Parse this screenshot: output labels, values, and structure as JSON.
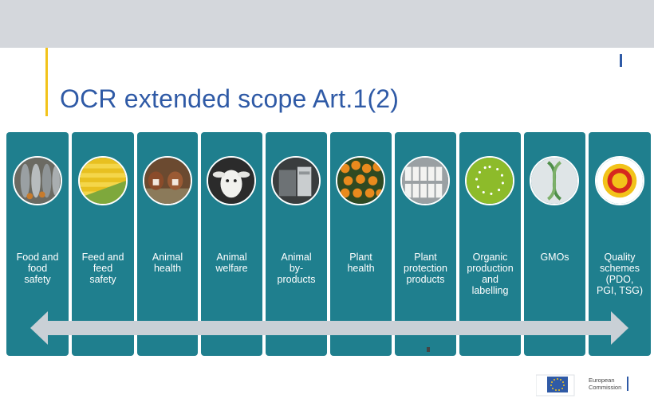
{
  "slide": {
    "title": "OCR extended scope Art.1(2)",
    "cards": [
      {
        "label": "Food and\nfood\nsafety",
        "icon": "fish-icon"
      },
      {
        "label": "Feed and\nfeed\nsafety",
        "icon": "corn-icon"
      },
      {
        "label": "Animal\nhealth",
        "icon": "cattle-icon"
      },
      {
        "label": "Animal\nwelfare",
        "icon": "goat-icon"
      },
      {
        "label": "Animal\nby-\nproducts",
        "icon": "byproducts-icon"
      },
      {
        "label": "Plant\nhealth",
        "icon": "citrus-icon"
      },
      {
        "label": "Plant\nprotection\nproducts",
        "icon": "bottles-icon"
      },
      {
        "label": "Organic\nproduction\nand\nlabelling",
        "icon": "organic-leaf-icon"
      },
      {
        "label": "GMOs",
        "icon": "dna-icon"
      },
      {
        "label": "Quality\nschemes\n(PDO,\nPGI, TSG)",
        "icon": "quality-seal-icon"
      }
    ]
  },
  "footer": {
    "logo_text": "European\nCommission",
    "logo_icon": "eu-flag-icon"
  },
  "colors": {
    "topbar": "#d4d7dc",
    "accent": "#f2c31a",
    "title": "#2f5aa6",
    "card": "#1f7f8e",
    "arrow": "#c9d0d6"
  }
}
